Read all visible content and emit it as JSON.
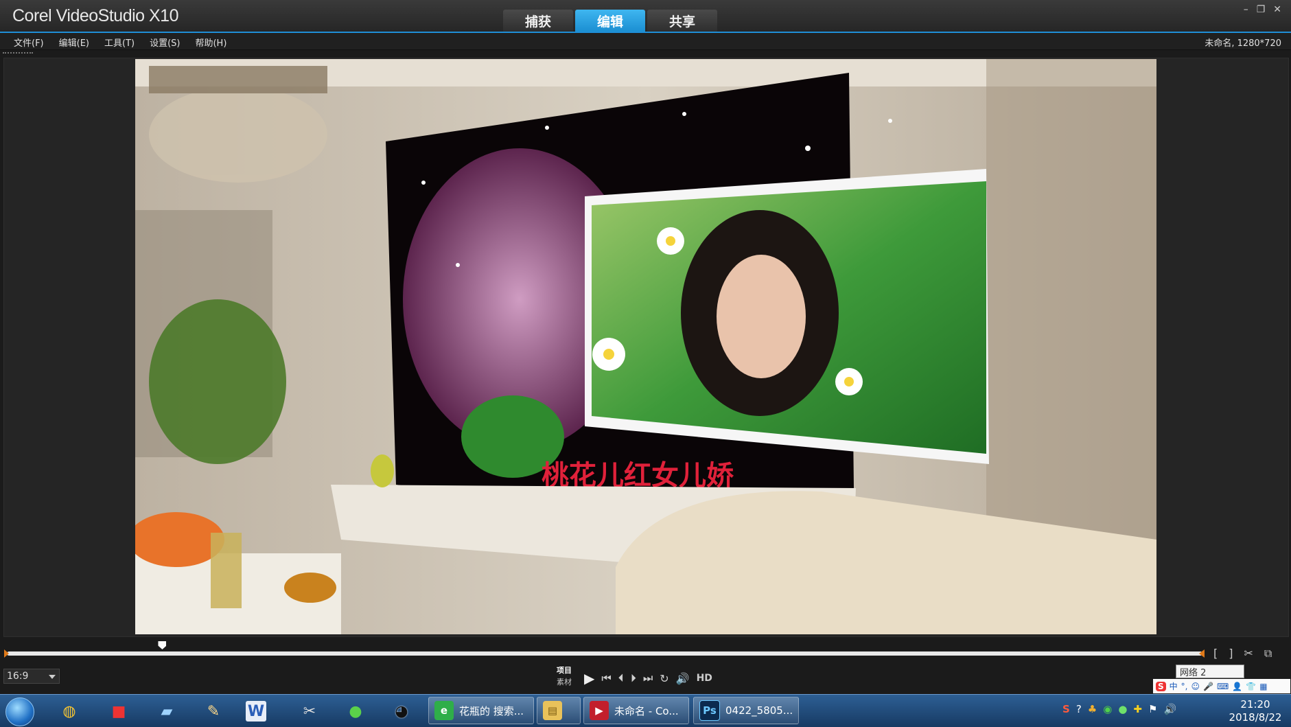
{
  "app": {
    "title": "Corel VideoStudio X10"
  },
  "tabs": [
    {
      "label": "捕获",
      "active": false
    },
    {
      "label": "编辑",
      "active": true
    },
    {
      "label": "共享",
      "active": false
    }
  ],
  "window_controls": {
    "minimize": "–",
    "restore": "❐",
    "close": "✕"
  },
  "menu": [
    "文件(F)",
    "编辑(E)",
    "工具(T)",
    "设置(S)",
    "帮助(H)"
  ],
  "project_info": "未命名, 1280*720",
  "preview": {
    "caption": "桃花儿红女儿娇",
    "scrub_position_fraction": 0.13
  },
  "trim_tools": {
    "mark_in": "[",
    "mark_out": "]",
    "split": "✂",
    "copy": "⧉"
  },
  "aspect_select": {
    "value": "16:9"
  },
  "mode": {
    "project": "项目",
    "clip": "素材"
  },
  "playback": {
    "play": "▶",
    "home": "⏮",
    "prev": "⏴",
    "next": "⏵",
    "end": "⏭",
    "repeat": "↻",
    "volume": "🔊",
    "hd": "HD"
  },
  "network_tooltip": "网络 2",
  "ime": {
    "logo": "S",
    "mode": "中",
    "punct": "°,",
    "face": "☺",
    "mic": "🎤",
    "keyboard": "⌨",
    "user": "👤",
    "skin": "👕",
    "tools": "▦"
  },
  "taskbar": {
    "pinned": [
      {
        "name": "browser",
        "glyph": "◍"
      },
      {
        "name": "recorder",
        "glyph": "■"
      },
      {
        "name": "files",
        "glyph": "▰"
      },
      {
        "name": "paint",
        "glyph": "✎"
      },
      {
        "name": "word",
        "glyph": "W"
      },
      {
        "name": "tool",
        "glyph": "✂"
      },
      {
        "name": "wechat",
        "glyph": "●"
      },
      {
        "name": "qq",
        "glyph": "◕"
      }
    ],
    "tasks": [
      {
        "label": "花瓶的 搜索...",
        "icon": "e",
        "color": "#2fae49"
      },
      {
        "label": "",
        "icon": "▤",
        "color": "#e9c25a"
      },
      {
        "label": "未命名 - Co...",
        "icon": "▶",
        "color": "#c21f2c"
      },
      {
        "label": "0422_5805...",
        "icon": "Ps",
        "color": "#0b2b4f"
      }
    ],
    "tray_icons": [
      "S",
      "?",
      "♣",
      "◉",
      "●",
      "✚",
      "⚑",
      "🔊"
    ],
    "clock": {
      "time": "21:20",
      "date": "2018/8/22"
    }
  }
}
